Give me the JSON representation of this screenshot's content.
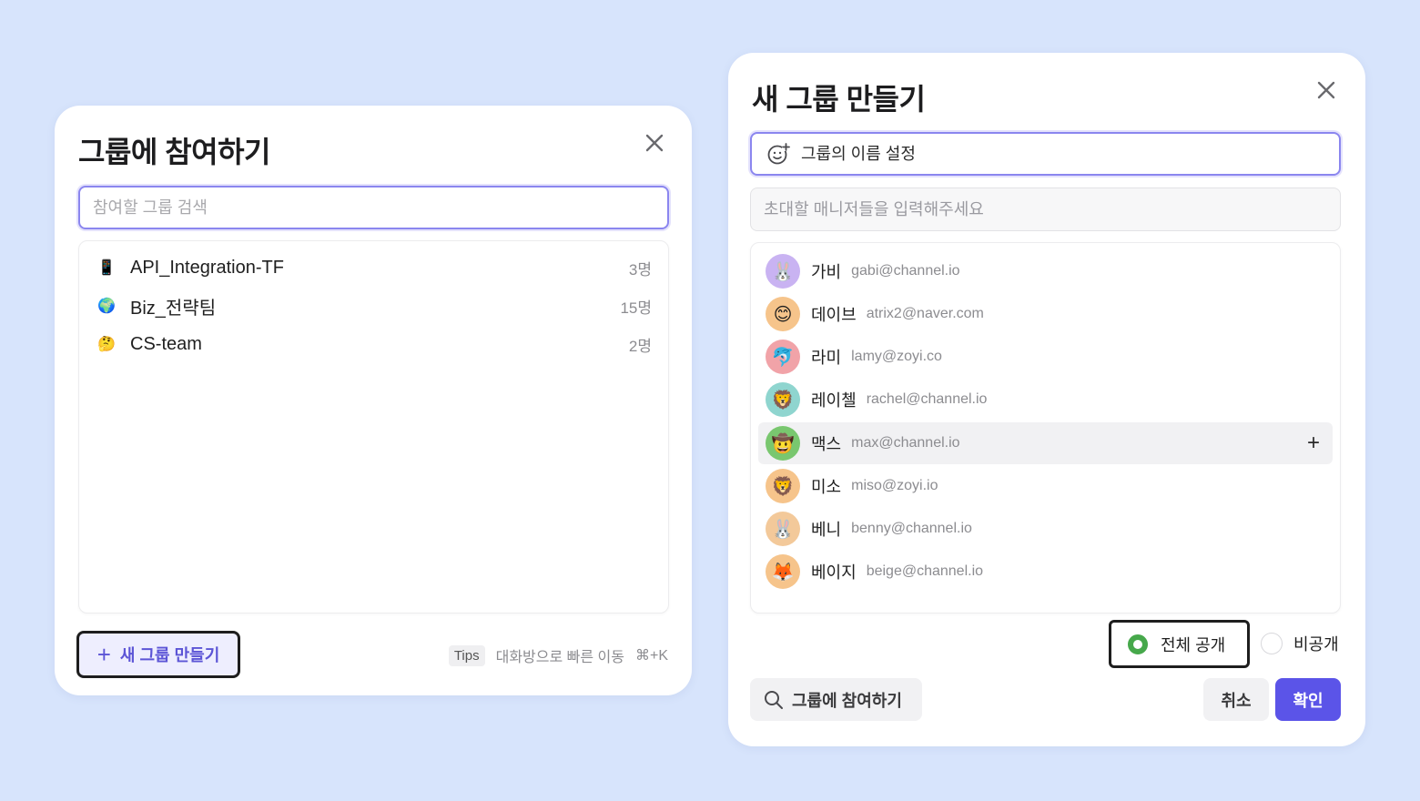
{
  "join_dialog": {
    "title": "그룹에 참여하기",
    "search_placeholder": "참여할 그룹 검색",
    "groups": [
      {
        "emoji": "📱",
        "name": "API_Integration-TF",
        "count": "3명"
      },
      {
        "emoji": "🌍",
        "name": "Biz_전략팀",
        "count": "15명"
      },
      {
        "emoji": "🤔",
        "name": "CS-team",
        "count": "2명"
      }
    ],
    "new_group_label": "새 그룹 만들기",
    "tips_badge": "Tips",
    "tips_text": "대화방으로 빠른 이동",
    "tips_shortcut": "⌘+K"
  },
  "create_dialog": {
    "title": "새 그룹 만들기",
    "name_placeholder": "그룹의 이름 설정",
    "invite_placeholder": "초대할 매니저들을 입력해주세요",
    "managers": [
      {
        "emoji": "🐰",
        "name": "가비",
        "email": "gabi@channel.io",
        "color": "#c9b3f2"
      },
      {
        "emoji": "😊",
        "name": "데이브",
        "email": "atrix2@naver.com",
        "color": "#f6c48b"
      },
      {
        "emoji": "🐬",
        "name": "라미",
        "email": "lamy@zoyi.co",
        "color": "#f1a3a8"
      },
      {
        "emoji": "🦁",
        "name": "레이첼",
        "email": "rachel@channel.io",
        "color": "#8fd5cf"
      },
      {
        "emoji": "🤠",
        "name": "맥스",
        "email": "max@channel.io",
        "color": "#79c76f"
      },
      {
        "emoji": "🦁",
        "name": "미소",
        "email": "miso@zoyi.io",
        "color": "#f6c48b"
      },
      {
        "emoji": "🐰",
        "name": "베니",
        "email": "benny@channel.io",
        "color": "#f3c99a"
      },
      {
        "emoji": "🦊",
        "name": "베이지",
        "email": "beige@channel.io",
        "color": "#f6c48b"
      }
    ],
    "public_label": "전체 공개",
    "private_label": "비공개",
    "join_group_label": "그룹에 참여하기",
    "cancel_label": "취소",
    "confirm_label": "확인"
  }
}
